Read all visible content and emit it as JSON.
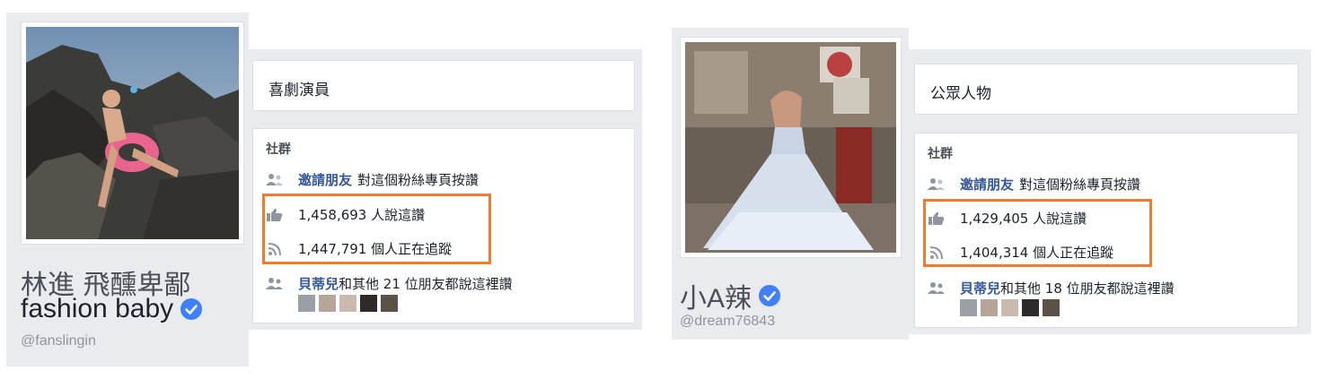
{
  "profiles": [
    {
      "name_zh": "林進 飛醺卑鄙",
      "name_en": "fashion baby",
      "handle": "@fanslingin",
      "category": "喜劇演員",
      "community": {
        "title": "社群",
        "invite_link": "邀請朋友",
        "invite_text": "對這個粉絲專頁按讚",
        "likes_text": "1,458,693 人說這讚",
        "follows_text": "1,447,791 個人正在追蹤",
        "friend_name": "貝蒂兒",
        "friends_text": "和其他 21 位朋友都說這裡讚"
      }
    },
    {
      "name_zh": "小A辣",
      "name_en": "",
      "handle": "@dream76843",
      "category": "公眾人物",
      "community": {
        "title": "社群",
        "invite_link": "邀請朋友",
        "invite_text": "對這個粉絲專頁按讚",
        "likes_text": "1,429,405 人說這讚",
        "follows_text": "1,404,314 個人正在追蹤",
        "friend_name": "貝蒂兒",
        "friends_text": "和其他 18 位朋友都說這裡讚"
      }
    }
  ],
  "icons": {
    "invite": "people-icon",
    "likes": "thumbs-up-icon",
    "follows": "rss-icon",
    "friends": "people-icon",
    "verified": "verified-badge-icon"
  },
  "colors": {
    "highlight": "#ed7d31",
    "link": "#365899",
    "verified": "#4080ff",
    "background": "#e9ebee"
  }
}
